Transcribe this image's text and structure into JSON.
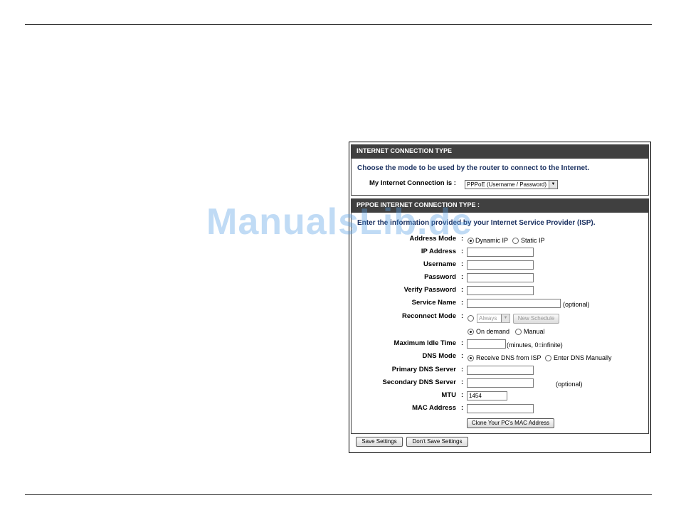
{
  "connection_type": {
    "header": "INTERNET CONNECTION TYPE",
    "intro": "Choose the mode to be used by the router to connect to the Internet.",
    "label": "My Internet Connection is :",
    "selected": "PPPoE (Username / Password)"
  },
  "pppoe": {
    "header": "PPPOE INTERNET CONNECTION TYPE :",
    "intro": "Enter the information provided by your Internet Service Provider (ISP).",
    "address_mode_label": "Address Mode",
    "address_mode_options": [
      "Dynamic IP",
      "Static IP"
    ],
    "ip_address_label": "IP Address",
    "username_label": "Username",
    "password_label": "Password",
    "verify_password_label": "Verify Password",
    "service_name_label": "Service Name",
    "service_name_note": "(optional)",
    "reconnect_mode_label": "Reconnect Mode",
    "schedule_selected": "Always",
    "new_schedule_label": "New Schedule",
    "reconnect_options": [
      "On demand",
      "Manual"
    ],
    "max_idle_label": "Maximum Idle Time",
    "max_idle_note": "(minutes, 0=infinite)",
    "dns_mode_label": "DNS Mode",
    "dns_mode_options": [
      "Receive DNS from ISP",
      "Enter DNS Manually"
    ],
    "primary_dns_label": "Primary DNS Server",
    "secondary_dns_label": "Secondary DNS Server",
    "secondary_dns_note": "(optional)",
    "mtu_label": "MTU",
    "mtu_value": "1454",
    "mac_label": "MAC Address",
    "clone_mac_label": "Clone Your PC's MAC Address"
  },
  "actions": {
    "save_label": "Save Settings",
    "dont_save_label": "Don't Save Settings"
  },
  "watermark": "ManualsLib.de"
}
